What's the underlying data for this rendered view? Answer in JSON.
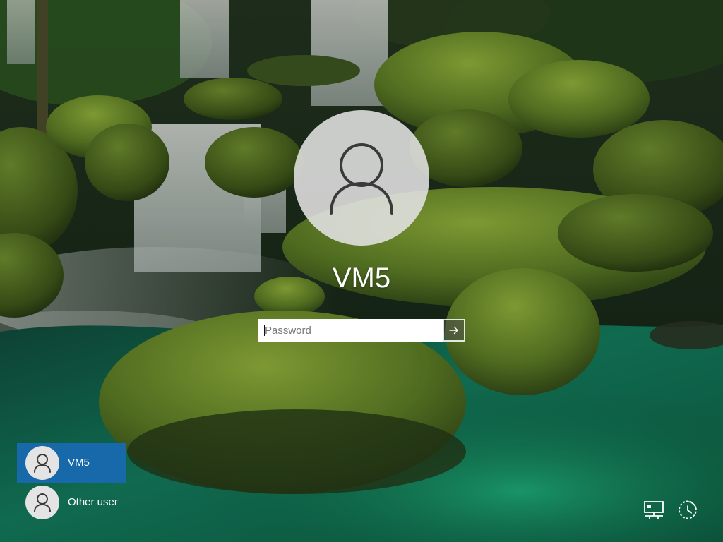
{
  "login": {
    "username": "VM5",
    "password_placeholder": "Password",
    "submit_icon": "arrow-right-icon"
  },
  "user_list": [
    {
      "name": "VM5",
      "selected": true,
      "icon": "user-avatar-icon"
    },
    {
      "name": "Other user",
      "selected": false,
      "icon": "user-avatar-icon"
    }
  ],
  "system_tray": {
    "network_icon": "network-icon",
    "ease_of_access_icon": "ease-of-access-icon"
  },
  "colors": {
    "selected_tile": "#1769aa",
    "avatar_bg": "#e2e2e2",
    "avatar_glyph": "#3a3a3a",
    "text": "#ffffff"
  }
}
